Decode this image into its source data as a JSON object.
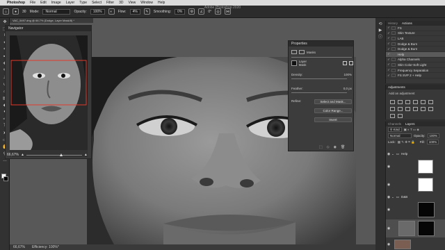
{
  "menubar": {
    "app_name": "Photoshop",
    "items": [
      "File",
      "Edit",
      "Image",
      "Layer",
      "Type",
      "Select",
      "Filter",
      "3D",
      "View",
      "Window",
      "Help"
    ],
    "right_text": ""
  },
  "window_title": "Adobe Photoshop 2020",
  "options_bar": {
    "mode_label": "Mode:",
    "mode_value": "Normal",
    "opacity_label": "Opacity:",
    "opacity_value": "100%",
    "flow_label": "Flow:",
    "flow_value": "4%",
    "smoothing_label": "Smoothing:",
    "smoothing_value": "0%",
    "angle_value": "0°"
  },
  "document_tab": "VAC_5497.dng @ 66.7% (Dodge, Layer Mask/8) *",
  "navigator": {
    "title": "Navigator",
    "zoom_value": "66,67%"
  },
  "properties": {
    "title": "Properties",
    "masks_label": "Masks",
    "layer_mask_label": "Layer Mask",
    "density_label": "Density:",
    "density_value": "100%",
    "feather_label": "Feather:",
    "feather_value": "0,0 px",
    "refine_label": "Refine:",
    "select_mask_button": "Select and Mask...",
    "color_range_button": "Color Range...",
    "invert_button": "Invert"
  },
  "actions_panel": {
    "tabs": [
      "History",
      "Actions"
    ],
    "active_tab": "Actions",
    "items": [
      {
        "label": "FS",
        "highlight": false
      },
      {
        "label": "Skin Texture",
        "highlight": false
      },
      {
        "label": "LAB",
        "highlight": false
      },
      {
        "label": "Dodge & Burn",
        "highlight": false
      },
      {
        "label": "Dodge & Burn",
        "highlight": false
      },
      {
        "label": "Help",
        "highlight": true
      },
      {
        "label": "Alpha Channels",
        "highlight": false
      },
      {
        "label": "Skin Color-Soft Light",
        "highlight": false
      },
      {
        "label": "Frequency Separation",
        "highlight": false
      },
      {
        "label": "FS SVP 2 + Help",
        "highlight": false
      }
    ]
  },
  "adjustments_panel": {
    "title": "Adjustments",
    "subtitle": "Add an adjustment"
  },
  "layers_panel": {
    "tabs": [
      "Channels",
      "Layers"
    ],
    "active_tab": "Layers",
    "kind_label": "Kind",
    "blend_mode": "Normal",
    "opacity_label": "Opacity:",
    "opacity_value": "100%",
    "lock_label": "Lock:",
    "fill_label": "Fill:",
    "fill_value": "100%",
    "groups": [
      {
        "name": "Help"
      },
      {
        "name": "D&B"
      }
    ]
  },
  "status_bar": {
    "zoom": "66,67%",
    "info": "Efficiency: 100%*"
  },
  "tools": [
    "move-icon",
    "marquee-icon",
    "lasso-icon",
    "quick-select-icon",
    "crop-icon",
    "eyedropper-icon",
    "healing-icon",
    "brush-icon",
    "clone-stamp-icon",
    "history-brush-icon",
    "eraser-icon",
    "gradient-icon",
    "blur-icon",
    "dodge-icon",
    "pen-icon",
    "type-icon",
    "path-select-icon",
    "shape-icon",
    "hand-icon",
    "zoom-icon"
  ]
}
